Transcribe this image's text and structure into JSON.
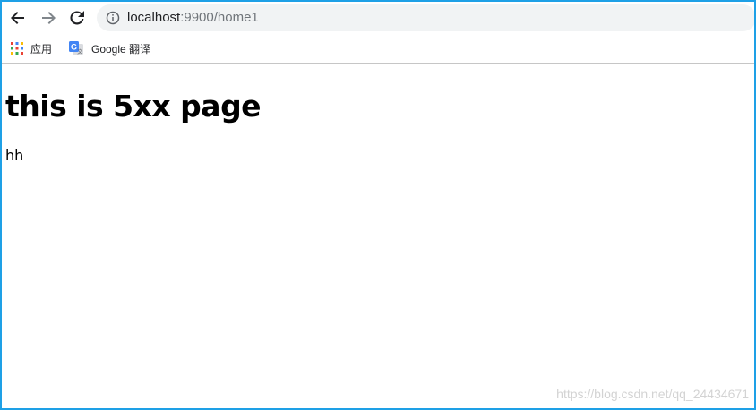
{
  "toolbar": {
    "back_icon": "arrow-left-icon",
    "forward_icon": "arrow-right-icon",
    "reload_icon": "reload-icon",
    "info_icon": "info-icon"
  },
  "address": {
    "host": "localhost",
    "rest": ":9900/home1"
  },
  "bookmarks": {
    "items": [
      {
        "icon": "apps-grid-icon",
        "label": "应用"
      },
      {
        "icon": "google-translate-icon",
        "label": "Google 翻译"
      }
    ]
  },
  "page": {
    "heading": "this is 5xx page",
    "text": "hh"
  },
  "watermark": "https://blog.csdn.net/qq_24434671",
  "colors": {
    "frame_border": "#1ea0e6",
    "addressbar_bg": "#f1f3f4",
    "url_host": "#202124",
    "url_rest": "#70757a"
  }
}
